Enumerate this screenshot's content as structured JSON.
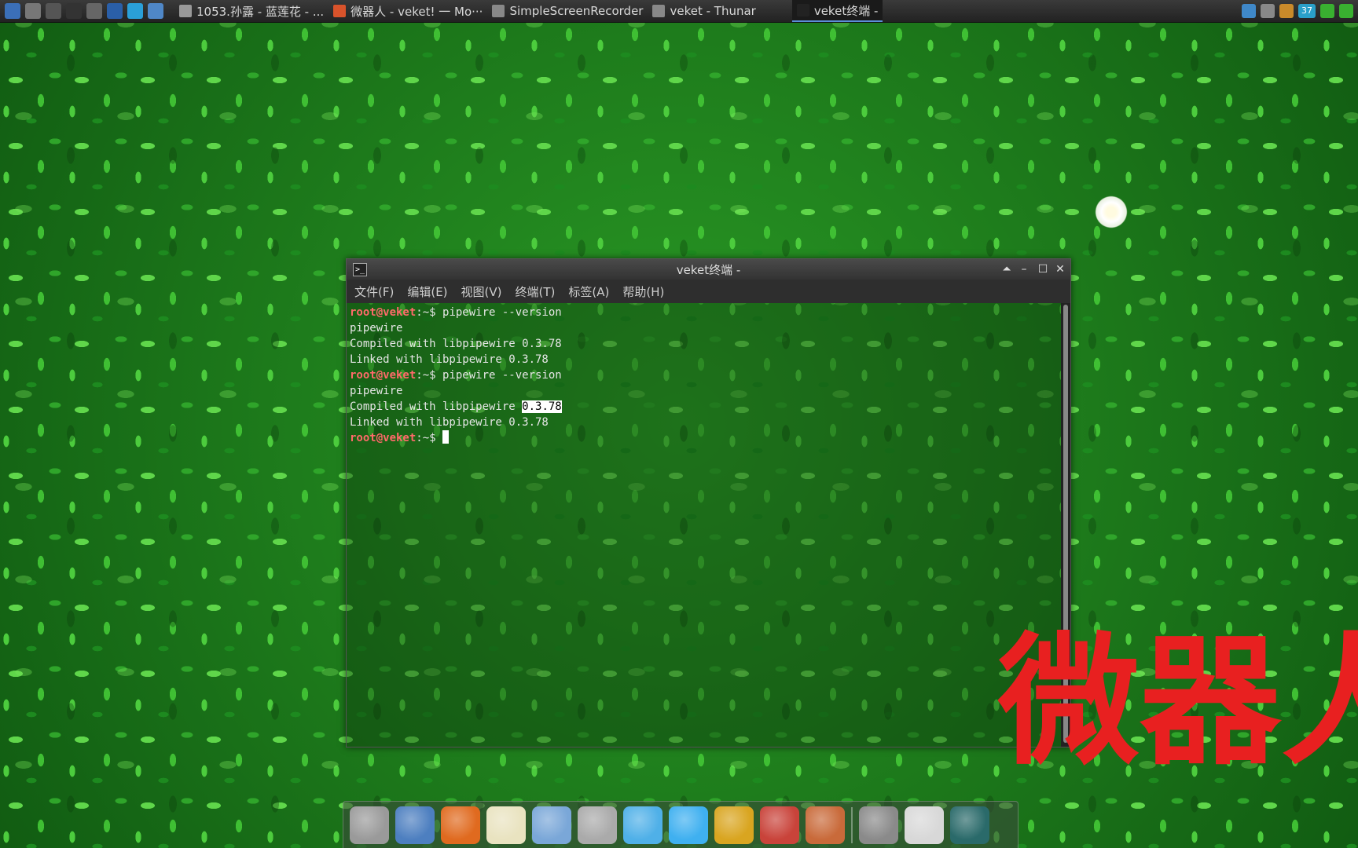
{
  "top_panel": {
    "launchers": [
      {
        "name": "system-monitor-icon",
        "color": "#3b6fb8"
      },
      {
        "name": "gear-bug-icon",
        "color": "#777777"
      },
      {
        "name": "play-icon",
        "color": "#555555"
      },
      {
        "name": "terminal-icon",
        "color": "#333333"
      },
      {
        "name": "screenshot-icon",
        "color": "#666666"
      },
      {
        "name": "photo-icon",
        "color": "#2a5fa8"
      },
      {
        "name": "clock-icon",
        "color": "#2a9fd8"
      },
      {
        "name": "browser-icon",
        "color": "#4f87c7"
      }
    ],
    "tasks": [
      {
        "label": "1053.孙露 - 蓝莲花 - ...",
        "icon": "media-player-icon",
        "color": "#999999",
        "active": false
      },
      {
        "label": "微器人 - veket! 一 Mo···",
        "icon": "firefox-icon",
        "color": "#d9532b",
        "active": false
      },
      {
        "label": "SimpleScreenRecorder",
        "icon": "folder-icon",
        "color": "#888888",
        "active": false
      },
      {
        "label": "veket - Thunar",
        "icon": "folder-icon",
        "color": "#888888",
        "active": false
      },
      {
        "label": "veket终端 -",
        "icon": "terminal-icon",
        "color": "#222222",
        "active": true
      }
    ],
    "tray": {
      "temperature": "37",
      "icons": [
        {
          "name": "display-icon",
          "color": "#3f88c9"
        },
        {
          "name": "window-icon",
          "color": "#888888"
        },
        {
          "name": "clipboard-icon",
          "color": "#c98a2a"
        },
        {
          "name": "temperature-icon",
          "color": "#2aa0c9"
        },
        {
          "name": "wifi-icon",
          "color": "#39b030"
        },
        {
          "name": "battery-icon",
          "color": "#39b030"
        }
      ]
    }
  },
  "terminal": {
    "title": "veket终端 -",
    "menu": [
      "文件(F)",
      "编辑(E)",
      "视图(V)",
      "终端(T)",
      "标签(A)",
      "帮助(H)"
    ],
    "prompt_user": "root@veket",
    "prompt_rest": ":~$ ",
    "lines": [
      {
        "type": "prompt",
        "cmd": "pipewire --version"
      },
      {
        "type": "out",
        "text": "pipewire"
      },
      {
        "type": "out",
        "text": "Compiled with libpipewire 0.3.78"
      },
      {
        "type": "out",
        "text": "Linked with libpipewire 0.3.78"
      },
      {
        "type": "prompt",
        "cmd": "pipewire --version"
      },
      {
        "type": "out",
        "text": "pipewire"
      },
      {
        "type": "out_hl",
        "before": "Compiled with libpipewire ",
        "hl": "0.3.78"
      },
      {
        "type": "out",
        "text": "Linked with libpipewire 0.3.78"
      },
      {
        "type": "prompt_cursor",
        "cmd": ""
      }
    ]
  },
  "overlay_text": "微器人",
  "dock": {
    "icons": [
      {
        "name": "home-folder-icon",
        "color": "#9a9a9a"
      },
      {
        "name": "my-computer-icon",
        "color": "#4d7fc0"
      },
      {
        "name": "firefox-icon",
        "color": "#e06a1f"
      },
      {
        "name": "text-editor-icon",
        "color": "#e9e3c0"
      },
      {
        "name": "image-viewer-icon",
        "color": "#7aa7d8"
      },
      {
        "name": "disc-burner-icon",
        "color": "#aaaaaa"
      },
      {
        "name": "network-icon",
        "color": "#4fb0e8"
      },
      {
        "name": "media-player-icon",
        "color": "#3fb0f0"
      },
      {
        "name": "door-exit-icon",
        "color": "#d9a520"
      },
      {
        "name": "spreadsheet-icon",
        "color": "#c9433a"
      },
      {
        "name": "rocket-icon",
        "color": "#c96a3a"
      },
      {
        "name": "separator",
        "color": ""
      },
      {
        "name": "drive-icon",
        "color": "#8a8a8a"
      },
      {
        "name": "settings-sun-icon",
        "color": "#d8d8d8"
      },
      {
        "name": "globe-icon",
        "color": "#2a6a6a"
      }
    ]
  }
}
